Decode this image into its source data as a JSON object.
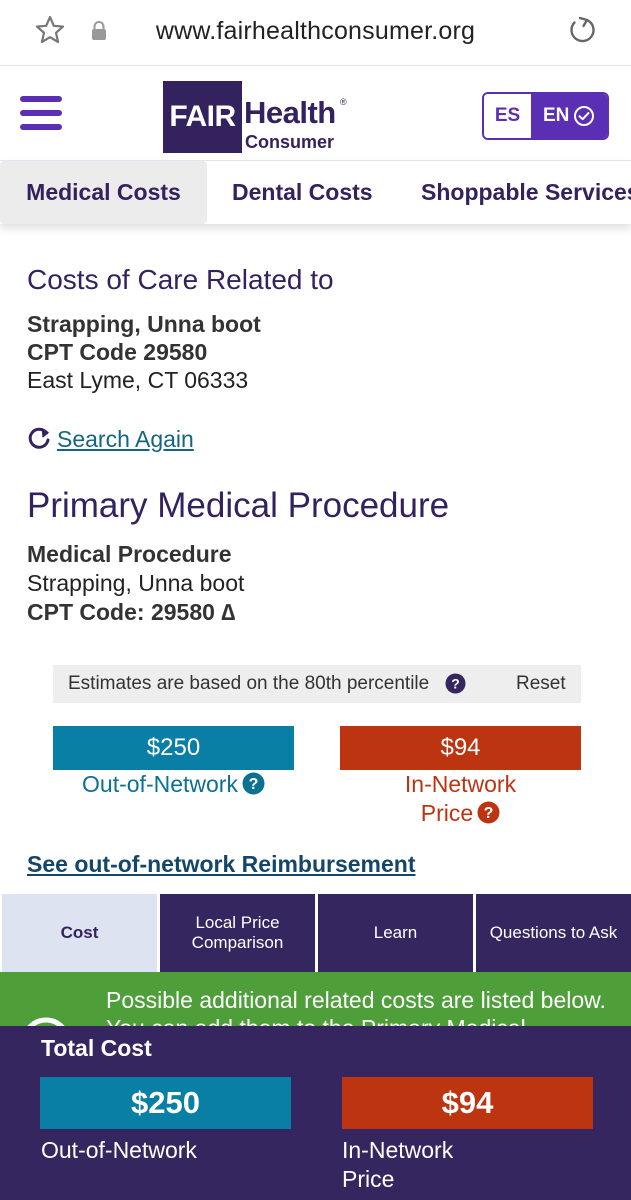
{
  "browser": {
    "url": "www.fairhealthconsumer.org"
  },
  "header": {
    "logo_fair": "FAIR",
    "logo_health": "Health",
    "logo_reg": "®",
    "logo_consumer": "Consumer",
    "lang_es": "ES",
    "lang_en": "EN"
  },
  "category_tabs": [
    {
      "label": "Medical Costs",
      "active": true
    },
    {
      "label": "Dental Costs",
      "active": false
    },
    {
      "label": "Shoppable Services",
      "active": false
    }
  ],
  "summary": {
    "heading": "Costs of Care Related to",
    "procedure": "Strapping, Unna boot",
    "cpt": "CPT Code 29580",
    "location": "East Lyme, CT 06333",
    "search_again": "Search Again"
  },
  "primary": {
    "heading": "Primary Medical Procedure",
    "label": "Medical Procedure",
    "name": "Strapping, Unna boot",
    "cpt": "CPT Code: 29580 ∆"
  },
  "percentile": {
    "text": "Estimates are based on the 80th percentile",
    "reset": "Reset"
  },
  "prices": {
    "out_value": "$250",
    "out_label": "Out-of-Network",
    "in_value": "$94",
    "in_label_1": "In-Network",
    "in_label_2": "Price"
  },
  "reimbursement_link": "See out-of-network Reimbursement",
  "result_tabs": [
    {
      "label": "Cost",
      "active": true
    },
    {
      "label": "Local Price Comparison",
      "active": false
    },
    {
      "label": "Learn",
      "active": false
    },
    {
      "label": "Questions to Ask",
      "active": false
    }
  ],
  "banner": {
    "text": "Possible additional related costs are listed below. You can add them to the Primary Medical"
  },
  "total": {
    "title": "Total Cost",
    "out_value": "$250",
    "out_label": "Out-of-Network",
    "in_value": "$94",
    "in_label": "In-Network Price"
  },
  "colors": {
    "brand_purple": "#34225e",
    "accent_purple": "#5b2fb4",
    "out_network_blue": "#0a7fa6",
    "in_network_red": "#bd3411",
    "banner_green": "#4e9e3a"
  }
}
